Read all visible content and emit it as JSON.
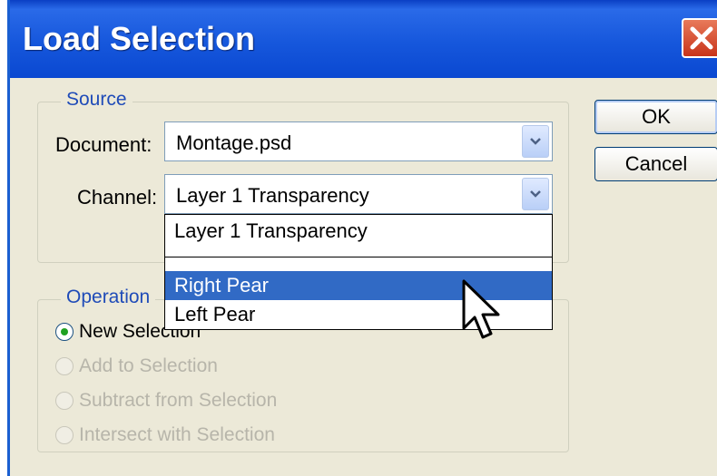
{
  "window": {
    "title": "Load Selection",
    "close_icon": "close-x-icon"
  },
  "source": {
    "legend": "Source",
    "document_label": "Document:",
    "document_value": "Montage.psd",
    "channel_label": "Channel:",
    "channel_value": "Layer 1 Transparency",
    "channel_options": [
      "Layer 1 Transparency",
      "Right Pear",
      "Left Pear"
    ],
    "highlighted_option": "Right Pear"
  },
  "buttons": {
    "ok": "OK",
    "cancel": "Cancel"
  },
  "operation": {
    "legend": "Operation",
    "options": [
      {
        "label": "New Selection",
        "selected": true,
        "enabled": true
      },
      {
        "label": "Add to Selection",
        "selected": false,
        "enabled": false
      },
      {
        "label": "Subtract from Selection",
        "selected": false,
        "enabled": false
      },
      {
        "label": "Intersect with Selection",
        "selected": false,
        "enabled": false
      }
    ]
  },
  "colors": {
    "titlebar": "#1657dc",
    "dialog_bg": "#ece9d8",
    "highlight": "#316ac5",
    "legend_text": "#1f4bb8",
    "close_button": "#c8341a"
  }
}
